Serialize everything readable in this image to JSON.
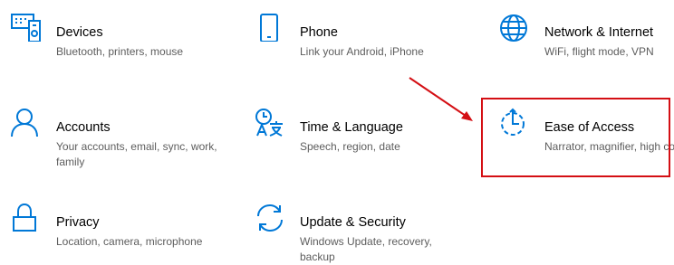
{
  "colors": {
    "accent": "#0078d7",
    "title": "#000000",
    "description": "#5d5d5d",
    "annotation": "#d40f14"
  },
  "tiles": [
    {
      "icon": "devices-icon",
      "title": "Devices",
      "description": "Bluetooth, printers, mouse"
    },
    {
      "icon": "phone-icon",
      "title": "Phone",
      "description": "Link your Android, iPhone"
    },
    {
      "icon": "globe-icon",
      "title": "Network & Internet",
      "description": "WiFi, flight mode, VPN"
    },
    {
      "icon": "person-icon",
      "title": "Accounts",
      "description": "Your accounts, email, sync, work, family"
    },
    {
      "icon": "time-language-icon",
      "title": "Time & Language",
      "description": "Speech, region, date"
    },
    {
      "icon": "ease-of-access-icon",
      "title": "Ease of Access",
      "description": "Narrator, magnifier, high contrast"
    },
    {
      "icon": "lock-icon",
      "title": "Privacy",
      "description": "Location, camera, microphone"
    },
    {
      "icon": "sync-icon",
      "title": "Update & Security",
      "description": "Windows Update, recovery, backup"
    }
  ],
  "annotation": {
    "highlighted_tile": "Ease of Access"
  }
}
